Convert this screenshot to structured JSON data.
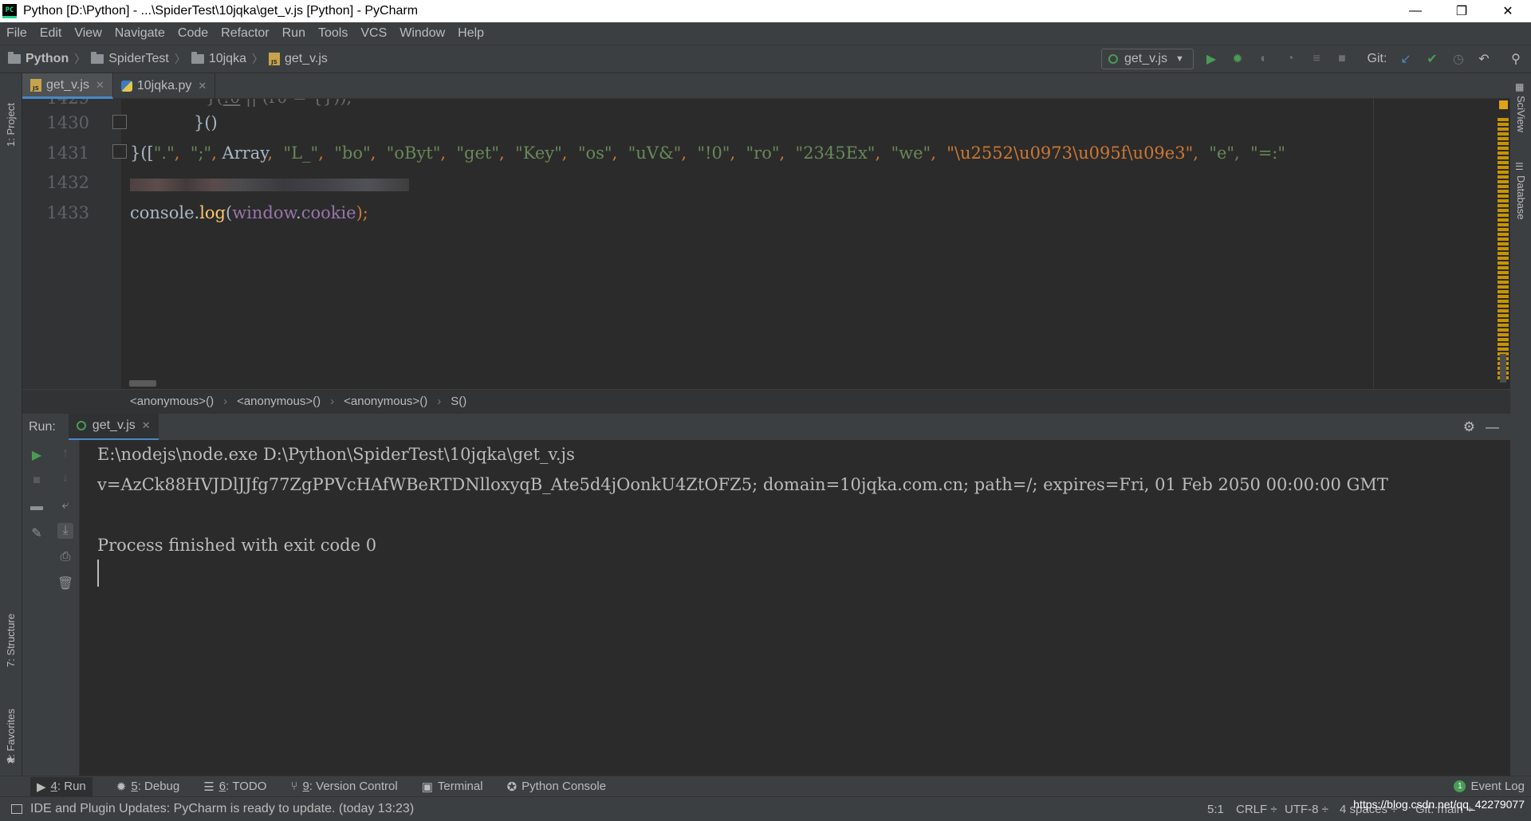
{
  "window": {
    "title": "Python [D:\\Python] - ...\\SpiderTest\\10jqka\\get_v.js [Python] - PyCharm",
    "icon_text": "PC",
    "minimize": "—",
    "restore": "❐",
    "close": "✕"
  },
  "menu": [
    "File",
    "Edit",
    "View",
    "Navigate",
    "Code",
    "Refactor",
    "Run",
    "Tools",
    "VCS",
    "Window",
    "Help"
  ],
  "breadcrumb": [
    "Python",
    "SpiderTest",
    "10jqka",
    "get_v.js"
  ],
  "run_config": {
    "label": "get_v.js"
  },
  "git_label": "Git:",
  "left_tools": [
    "1: Project",
    "7: Structure",
    "2: Favorites"
  ],
  "right_tools": [
    "SciView",
    "Database"
  ],
  "editor_tabs": [
    {
      "label": "get_v.js",
      "active": true
    },
    {
      "label": "10jqka.py",
      "active": false
    }
  ],
  "code": {
    "partial_top": "1429",
    "line_1430": {
      "no": "1430",
      "text": "}()"
    },
    "line_1431": {
      "no": "1431",
      "prefix": "}([",
      "strings": [
        "\".\"",
        "\";\""
      ],
      "array": "Array",
      "strings2": [
        "\"L_\"",
        "\"bo\"",
        "\"oByt\"",
        "\"get\"",
        "\"Key\"",
        "\"os\"",
        "\"uV&\"",
        "\"!0\"",
        "\"ro\"",
        "\"2345Ex\"",
        "\"we\""
      ],
      "escape_str": "\"\\u2552\\u0973\\u095f\\u09e3\"",
      "tail": "\"e\",  \"=:\""
    },
    "line_1432": {
      "no": "1432"
    },
    "line_1433": {
      "no": "1433",
      "obj": "console",
      "method": "log",
      "arg_obj": "window",
      "arg_prop": "cookie",
      "end": ");"
    }
  },
  "code_breadcrumbs": [
    "<anonymous>()",
    "<anonymous>()",
    "<anonymous>()",
    "S()"
  ],
  "run": {
    "label": "Run:",
    "tab": "get_v.js",
    "output": [
      "E:\\nodejs\\node.exe D:\\Python\\SpiderTest\\10jqka\\get_v.js",
      "v=AzCk88HVJDlJJfg77ZgPPVcHAfWBeRTDNlloxyqB_Ate5d4jOonkU4ZtOFZ5; domain=10jqka.com.cn; path=/; expires=Fri, 01 Feb 2050 00:00:00 GMT",
      "",
      "Process finished with exit code 0"
    ]
  },
  "bottom_tabs": [
    {
      "num": "4",
      "label": "Run",
      "icon": "play-icon"
    },
    {
      "num": "5",
      "label": "Debug",
      "icon": "bug-icon"
    },
    {
      "num": "6",
      "label": "TODO",
      "icon": "list-icon"
    },
    {
      "num": "9",
      "label": "Version Control",
      "icon": "branch-icon"
    },
    {
      "num": "",
      "label": "Terminal",
      "icon": "terminal-icon"
    },
    {
      "num": "",
      "label": "Python Console",
      "icon": "python-icon"
    }
  ],
  "event_log": {
    "count": "1",
    "label": "Event Log"
  },
  "status": {
    "message": "IDE and Plugin Updates: PyCharm is ready to update. (today 13:23)",
    "position": "5:1",
    "line_sep": "CRLF ÷",
    "encoding": "UTF-8 ÷",
    "indent": "4 spaces ÷",
    "git": "Git: main ÷",
    "watermark": "https://blog.csdn.net/qq_42279077"
  },
  "colors": {
    "accent": "#4a88c7",
    "run_green": "#499c54",
    "string": "#6a8759",
    "keyword": "#cc7832"
  }
}
